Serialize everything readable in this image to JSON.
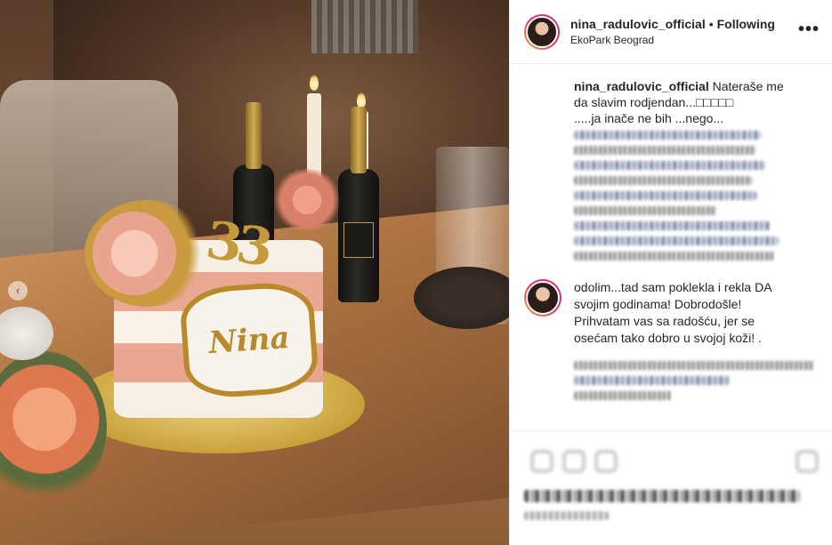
{
  "post": {
    "username": "nina_radulovic_official",
    "follow_status": "Following",
    "separator": "•",
    "location": "EkoPark Beograd",
    "more_icon": "more-options-icon",
    "more_label": "•••"
  },
  "photo": {
    "cake_name": "Nina",
    "topper_number": "33",
    "prev_icon": "chevron-left-icon",
    "prev_label": "‹"
  },
  "caption": {
    "username": "nina_radulovic_official",
    "line1": " Nateraše me",
    "line2": "da slavim rodjendan...□□□□□",
    "line3": ".....ja inače ne bih ...nego..."
  },
  "comment": {
    "text_line1": "odolim...tad sam poklekla i rekla DA",
    "text_line2": "svojim godinama! Dobrodošle!",
    "text_line3": "Prihvatam vas sa radošću, jer se",
    "text_line4": "osećam tako dobro u svojoj koži! ."
  },
  "colors": {
    "text": "#262626",
    "border": "#efefef",
    "story_ring_start": "#f9a13a",
    "story_ring_end": "#c13584",
    "link_blue": "#4b5a82"
  }
}
